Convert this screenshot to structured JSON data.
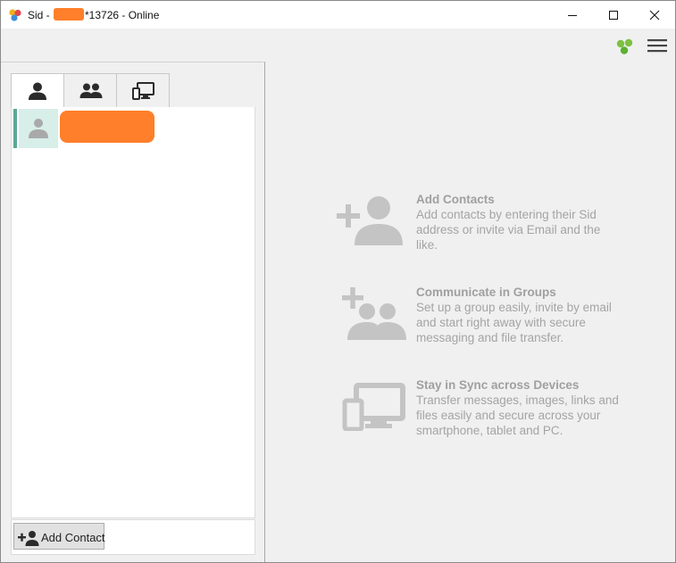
{
  "window": {
    "title_prefix": "Sid - ",
    "title_suffix": "*13726 - Online",
    "minimize_label": "Minimize",
    "maximize_label": "Maximize",
    "close_label": "Close"
  },
  "colors": {
    "accent": "#5aa895",
    "redaction": "#ff7f2a",
    "status_online": "#7dc142",
    "info_text": "#a4a4a4"
  },
  "icons": {
    "app": "sid-logo-icon",
    "status": "online-status-icon",
    "menu": "hamburger-menu-icon",
    "tab_contacts": "person-icon",
    "tab_groups": "group-icon",
    "tab_devices": "devices-icon"
  },
  "tabs": [
    {
      "id": "contacts",
      "active": true
    },
    {
      "id": "groups",
      "active": false
    },
    {
      "id": "devices",
      "active": false
    }
  ],
  "contacts": [
    {
      "name": "",
      "selected": true
    }
  ],
  "bottom": {
    "add_contact_label": "Add Contact"
  },
  "info": [
    {
      "heading": "Add Contacts",
      "body": "Add contacts by entering their Sid address or invite via Email and the like.",
      "icon": "add-person-icon"
    },
    {
      "heading": "Communicate in Groups",
      "body": "Set up a group easily, invite by email and start right away with secure messaging and file transfer.",
      "icon": "add-group-icon"
    },
    {
      "heading": "Stay in Sync across Devices",
      "body": "Transfer messages, images, links and files easily and secure across your smartphone, tablet and PC.",
      "icon": "devices-sync-icon"
    }
  ]
}
